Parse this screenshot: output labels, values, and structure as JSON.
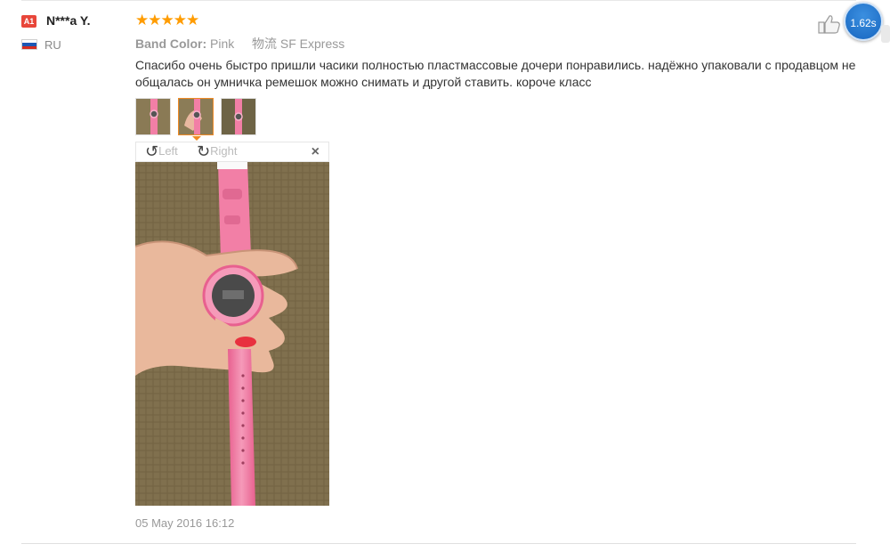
{
  "user": {
    "badge": "A1",
    "name": "N***a Y.",
    "country": "RU",
    "flag_colors": [
      "#ffffff",
      "#1c57b4",
      "#d52b1e"
    ]
  },
  "review": {
    "stars": "★★★★★",
    "rating": 5,
    "attributes": {
      "band_color_key": "Band Color:",
      "band_color_value": "Pink",
      "logistics_key": "物流",
      "logistics_value": "SF Express"
    },
    "text": "Спасибо очень быстро пришли часики полностью пластмассовые дочери понравились. надёжно упаковали с продавцом не общалась он умничка ремешок можно снимать и другой ставить. короче класс",
    "date": "05 May 2016 16:12"
  },
  "viewer": {
    "rotate_left": "Left",
    "rotate_right": "Right",
    "close": "×",
    "thumbnail_count": 3,
    "active_thumbnail": 2
  },
  "widgets": {
    "speed_badge": "1.62s"
  },
  "colors": {
    "accent_orange": "#f08a24",
    "star_color": "#ff9c00",
    "badge_red": "#e8463a",
    "watch_pink": "#f27fa6"
  }
}
